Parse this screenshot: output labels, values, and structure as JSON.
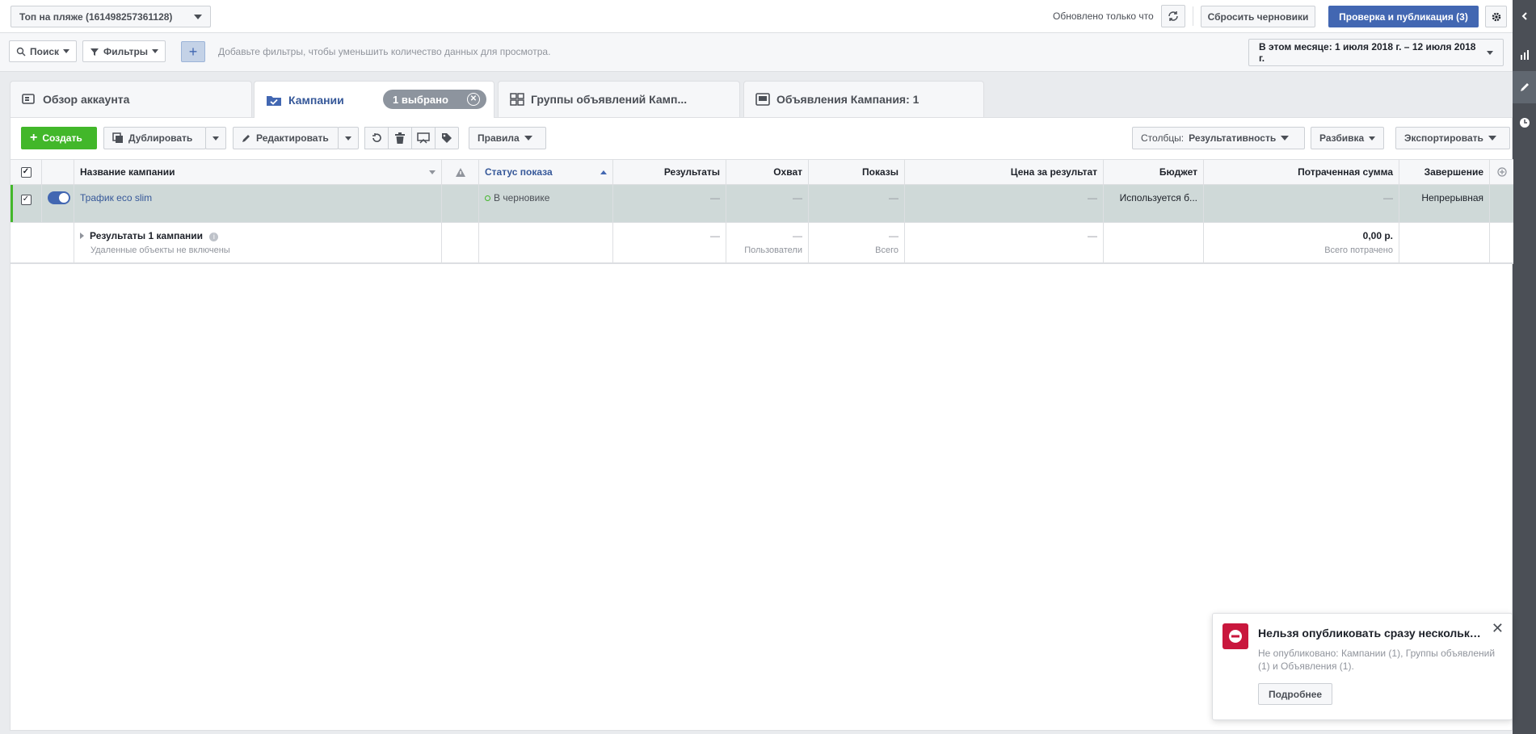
{
  "topbar": {
    "account": "Топ на пляже (161498257361128)",
    "updated": "Обновлено только что",
    "reset_label": "Сбросить черновики",
    "publish_label": "Проверка и публикация (3)"
  },
  "filterbar": {
    "search_label": "Поиск",
    "filters_label": "Фильтры",
    "plus": "+",
    "hint": "Добавьте фильтры, чтобы уменьшить количество данных для просмотра.",
    "date_range": "В этом месяце: 1 июля 2018 г. – 12 июля 2018 г."
  },
  "tabs": {
    "account": "Обзор аккаунта",
    "campaigns": "Кампании",
    "selected_pill": "1 выбрано",
    "adsets": "Группы объявлений Камп...",
    "ads": "Объявления Кампания: 1"
  },
  "toolbar": {
    "create": "Создать",
    "duplicate": "Дублировать",
    "edit": "Редактировать",
    "rules": "Правила",
    "columns_prefix": "Столбцы:",
    "columns_value": "Результативность",
    "breakdown": "Разбивка",
    "export": "Экспортировать"
  },
  "table": {
    "headers": {
      "name": "Название кампании",
      "status": "Статус показа",
      "results": "Результаты",
      "reach": "Охват",
      "impressions": "Показы",
      "cost": "Цена за результат",
      "budget": "Бюджет",
      "spent": "Потраченная сумма",
      "end": "Завершение"
    },
    "row1": {
      "name": "Трафик eco slim",
      "status": "В черновике",
      "results": "—",
      "reach": "—",
      "impressions": "—",
      "cost": "—",
      "budget": "Используется б...",
      "spent": "—",
      "end": "Непрерывная"
    },
    "summary": {
      "title": "Результаты 1 кампании",
      "subtitle": "Удаленные объекты не включены",
      "results": "—",
      "reach": "—",
      "reach_sub": "Пользователи",
      "impressions": "—",
      "impressions_sub": "Всего",
      "cost": "—",
      "spent": "0,00 р.",
      "spent_sub": "Всего потрачено"
    }
  },
  "toast": {
    "title": "Нельзя опубликовать сразу несколько о...",
    "body": "Не опубликовано: Кампании (1), Группы объявлений (1) и Объявления (1).",
    "button": "Подробнее"
  }
}
